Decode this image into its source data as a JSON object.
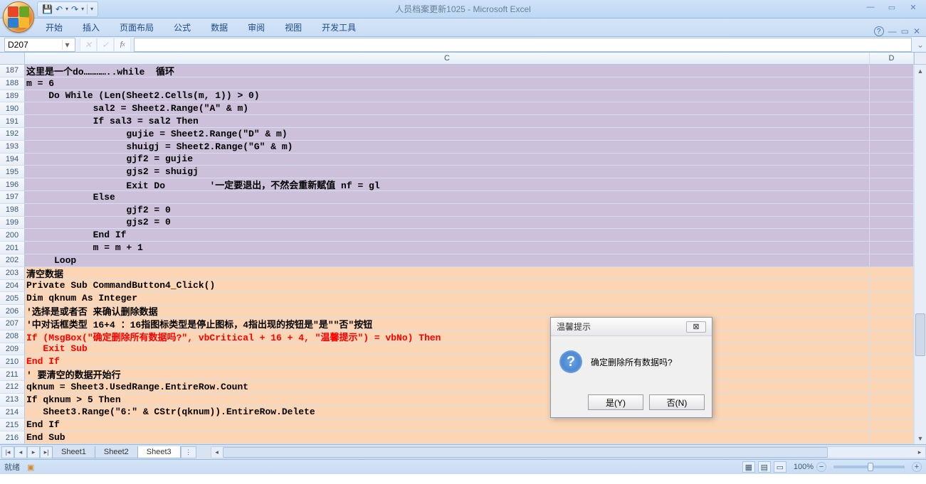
{
  "title": "人员档案更新1025 - Microsoft Excel",
  "ribbon_tabs": [
    "开始",
    "插入",
    "页面布局",
    "公式",
    "数据",
    "审阅",
    "视图",
    "开发工具"
  ],
  "namebox": "D207",
  "formula_value": "",
  "columns": [
    "C",
    "D"
  ],
  "rows": [
    {
      "n": 187,
      "bg": "purple",
      "txt": "这里是一个do…………..while  循环"
    },
    {
      "n": 188,
      "bg": "purple",
      "txt": "m = 6"
    },
    {
      "n": 189,
      "bg": "purple",
      "txt": "    Do While (Len(Sheet2.Cells(m, 1)) > 0)"
    },
    {
      "n": 190,
      "bg": "purple",
      "txt": "            sal2 = Sheet2.Range(\"A\" & m)"
    },
    {
      "n": 191,
      "bg": "purple",
      "txt": "            If sal3 = sal2 Then"
    },
    {
      "n": 192,
      "bg": "purple",
      "txt": "                  gujie = Sheet2.Range(\"D\" & m)"
    },
    {
      "n": 193,
      "bg": "purple",
      "txt": "                  shuigj = Sheet2.Range(\"G\" & m)"
    },
    {
      "n": 194,
      "bg": "purple",
      "txt": "                  gjf2 = gujie"
    },
    {
      "n": 195,
      "bg": "purple",
      "txt": "                  gjs2 = shuigj"
    },
    {
      "n": 196,
      "bg": "purple",
      "txt": "                  Exit Do        '一定要退出，不然会重新赋值 nf = gl"
    },
    {
      "n": 197,
      "bg": "purple",
      "txt": "            Else"
    },
    {
      "n": 198,
      "bg": "purple",
      "txt": "                  gjf2 = 0"
    },
    {
      "n": 199,
      "bg": "purple",
      "txt": "                  gjs2 = 0"
    },
    {
      "n": 200,
      "bg": "purple",
      "txt": "            End If"
    },
    {
      "n": 201,
      "bg": "purple",
      "txt": "            m = m + 1"
    },
    {
      "n": 202,
      "bg": "purple",
      "txt": "     Loop"
    },
    {
      "n": 203,
      "bg": "orange",
      "txt": "清空数据"
    },
    {
      "n": 204,
      "bg": "orange",
      "txt": "Private Sub CommandButton4_Click()"
    },
    {
      "n": 205,
      "bg": "orange",
      "txt": "Dim qknum As Integer"
    },
    {
      "n": 206,
      "bg": "orange",
      "txt": "'选择是或者否 来确认删除数据"
    },
    {
      "n": 207,
      "bg": "orange",
      "txt": "'中对话框类型 16+4 ：16指图标类型是停止图标，4指出现的按钮是\"是\"\"否\"按钮"
    },
    {
      "n": 208,
      "bg": "orange",
      "cls": "txt-red",
      "txt": "If (MsgBox(\"确定删除所有数据吗?\", vbCritical + 16 + 4, \"温馨提示\") = vbNo) Then"
    },
    {
      "n": 209,
      "bg": "orange",
      "cls": "txt-red",
      "txt": "   Exit Sub"
    },
    {
      "n": 210,
      "bg": "orange",
      "cls": "txt-red",
      "txt": "End If"
    },
    {
      "n": 211,
      "bg": "orange",
      "txt": "' 要清空的数据开始行"
    },
    {
      "n": 212,
      "bg": "orange",
      "txt": "qknum = Sheet3.UsedRange.EntireRow.Count"
    },
    {
      "n": 213,
      "bg": "orange",
      "txt": "If qknum > 5 Then"
    },
    {
      "n": 214,
      "bg": "orange",
      "txt": "   Sheet3.Range(\"6:\" & CStr(qknum)).EntireRow.Delete"
    },
    {
      "n": 215,
      "bg": "orange",
      "txt": "End If"
    },
    {
      "n": 216,
      "bg": "orange",
      "txt": "End Sub"
    }
  ],
  "sheet_tabs": [
    "Sheet1",
    "Sheet2",
    "Sheet3"
  ],
  "active_sheet": 2,
  "status_text": "就绪",
  "zoom": "100%",
  "dialog": {
    "title": "温馨提示",
    "message": "确定删除所有数据吗?",
    "btn_yes": "是(Y)",
    "btn_no": "否(N)"
  }
}
